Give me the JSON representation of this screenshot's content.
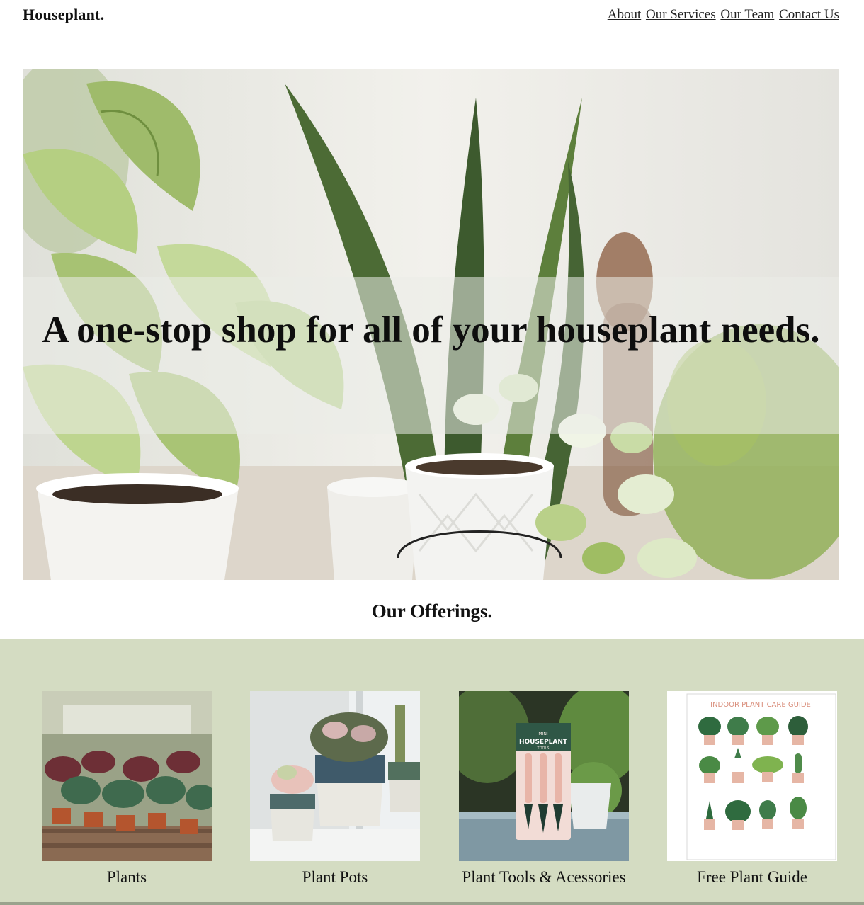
{
  "brand": {
    "name": "Houseplant."
  },
  "nav": {
    "items": [
      "About",
      "Our Services",
      "Our Team",
      "Contact Us"
    ]
  },
  "hero": {
    "headline": "A one-stop shop for all of your houseplant needs."
  },
  "offerings": {
    "title": "Our Offerings.",
    "cards": [
      {
        "label": "Plants"
      },
      {
        "label": "Plant Pots"
      },
      {
        "label": "Plant Tools & Acessories",
        "packaging_text": [
          "MINI",
          "HOUSEPLANT",
          "TOOLS"
        ]
      },
      {
        "label": "Free Plant Guide",
        "poster_title": "INDOOR PLANT CARE GUIDE"
      }
    ]
  },
  "colors": {
    "offerings_bg": "#d4dcc2",
    "leaf_green": "#6f9a3f",
    "pink_pot": "#e6b6a5"
  }
}
